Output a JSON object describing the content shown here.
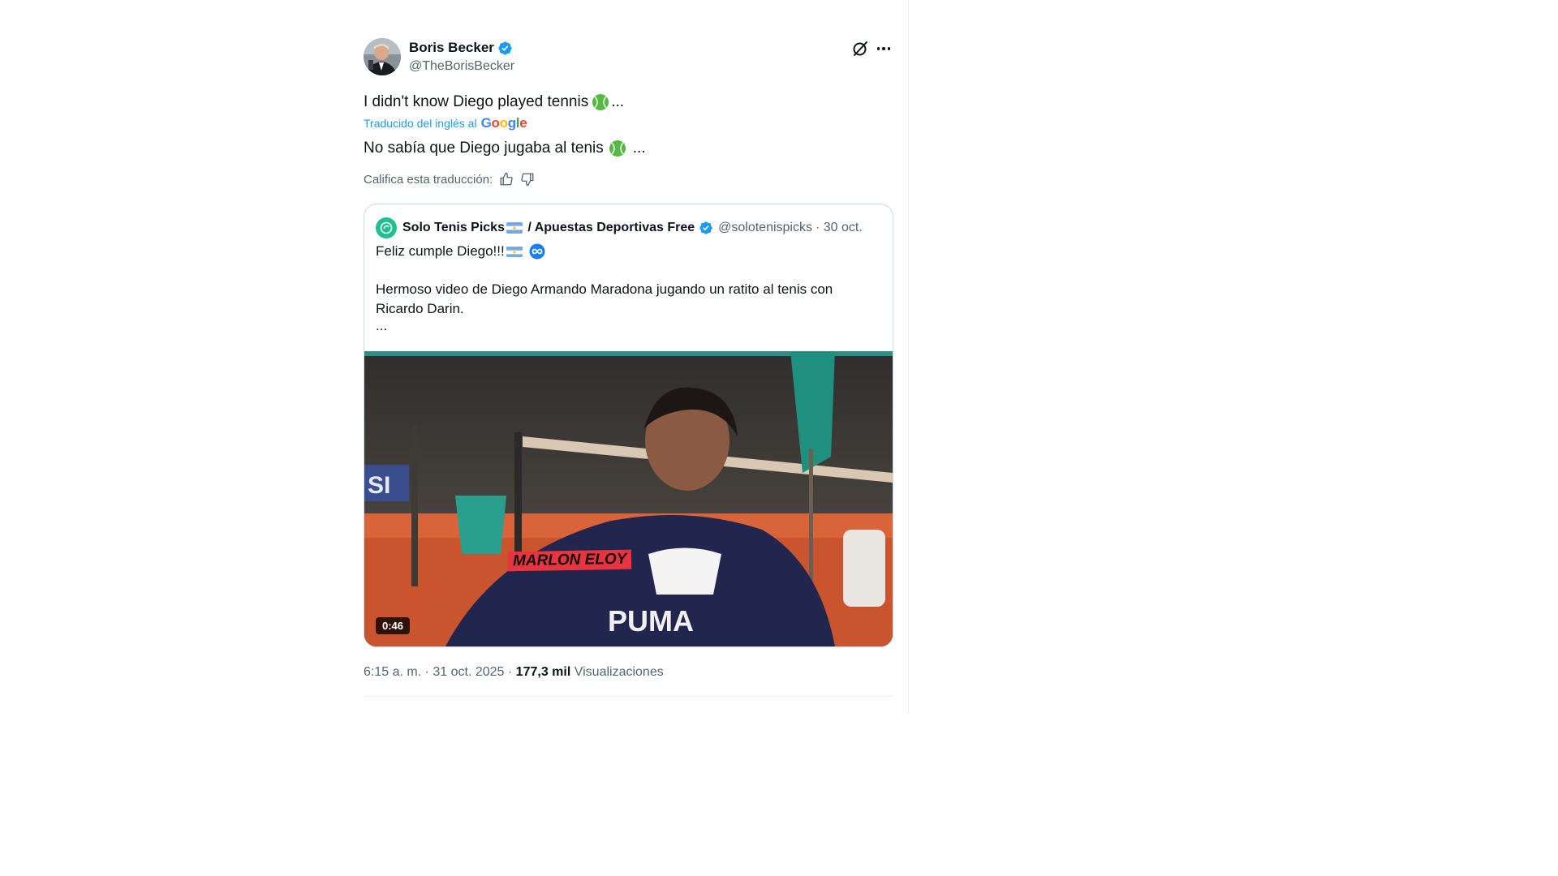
{
  "author": {
    "name": "Boris Becker",
    "handle": "@TheBorisBecker"
  },
  "tweet": {
    "text": "I didn't know Diego played tennis",
    "text_suffix": "...",
    "translated_label": "Traducido del inglés al",
    "translation_provider": "Google",
    "translated_text": "No sabía que Diego jugaba al tenis",
    "translated_suffix": "...",
    "rate_label": "Califica esta traducción:"
  },
  "quote": {
    "name_part1": "Solo Tenis Picks",
    "name_part2": "/ Apuestas Deportivas Free",
    "handle": "@solotenispicks",
    "date": "· 30 oct.",
    "line1": "Feliz cumple Diego!!!",
    "line2": "Hermoso video de Diego Armando Maradona jugando un ratito al tenis con Ricardo Darin.",
    "ellipsis": "...",
    "video_overlay_text": "MARLON ELOY",
    "video_duration": "0:46"
  },
  "meta": {
    "time_date": "6:15 a. m. · 31 oct. 2025 ·",
    "views_count": "177,3 mil",
    "views_label": "Visualizaciones"
  },
  "colors": {
    "accent_blue": "#1d9bf0",
    "secondary_text": "#536471",
    "border": "#cfd9de",
    "tennis_ball_green": "#55b944",
    "quote_avatar_green": "#1fbf91"
  },
  "icons": {
    "verified": "verified-badge-icon",
    "grok": "grok-icon",
    "more": "more-icon",
    "thumbs_up": "thumbs-up-icon",
    "thumbs_down": "thumbs-down-icon"
  }
}
